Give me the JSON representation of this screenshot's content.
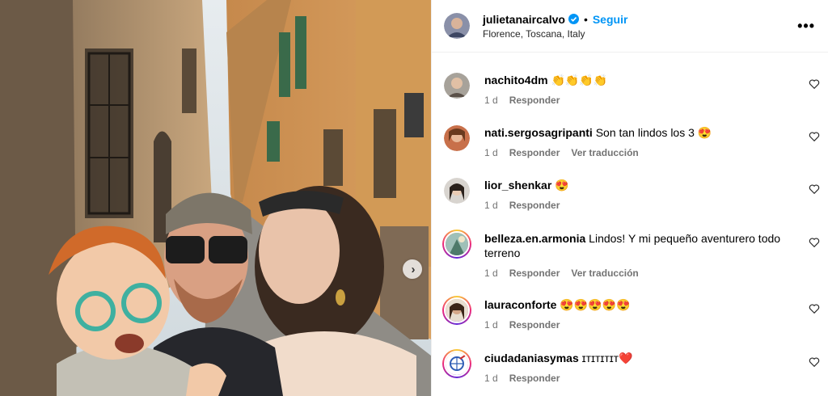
{
  "post": {
    "username": "julietanaircalvo",
    "follow_label": "Seguir",
    "separator": "•",
    "location": "Florence, Toscana, Italy",
    "more_label": "•••",
    "next_label": "›"
  },
  "colors": {
    "accent": "#0095f6",
    "verified": "#0095f6",
    "meta": "#737373"
  },
  "comments": [
    {
      "user": "nachito4dm",
      "text": "👏👏👏👏",
      "time": "1 d",
      "reply": "Responder",
      "translate": ""
    },
    {
      "user": "nati.sergosagripanti",
      "text": "Son tan lindos los 3 😍",
      "time": "1 d",
      "reply": "Responder",
      "translate": "Ver traducción"
    },
    {
      "user": "lior_shenkar",
      "text": "😍",
      "time": "1 d",
      "reply": "Responder",
      "translate": ""
    },
    {
      "user": "belleza.en.armonia",
      "text": "Lindos! Y mi pequeño aventurero todo terreno",
      "time": "1 d",
      "reply": "Responder",
      "translate": "Ver traducción"
    },
    {
      "user": "lauraconforte",
      "text": "😍😍😍😍😍",
      "time": "1 d",
      "reply": "Responder",
      "translate": ""
    },
    {
      "user": "ciudadaniasymas",
      "text": "ɪᴛɪᴛɪᴛɪᴛ❤️",
      "time": "1 d",
      "reply": "Responder",
      "translate": ""
    }
  ],
  "icons": {
    "verified": "verified-badge-icon",
    "more": "more-options-icon",
    "heart": "heart-icon",
    "next": "chevron-right-icon"
  }
}
